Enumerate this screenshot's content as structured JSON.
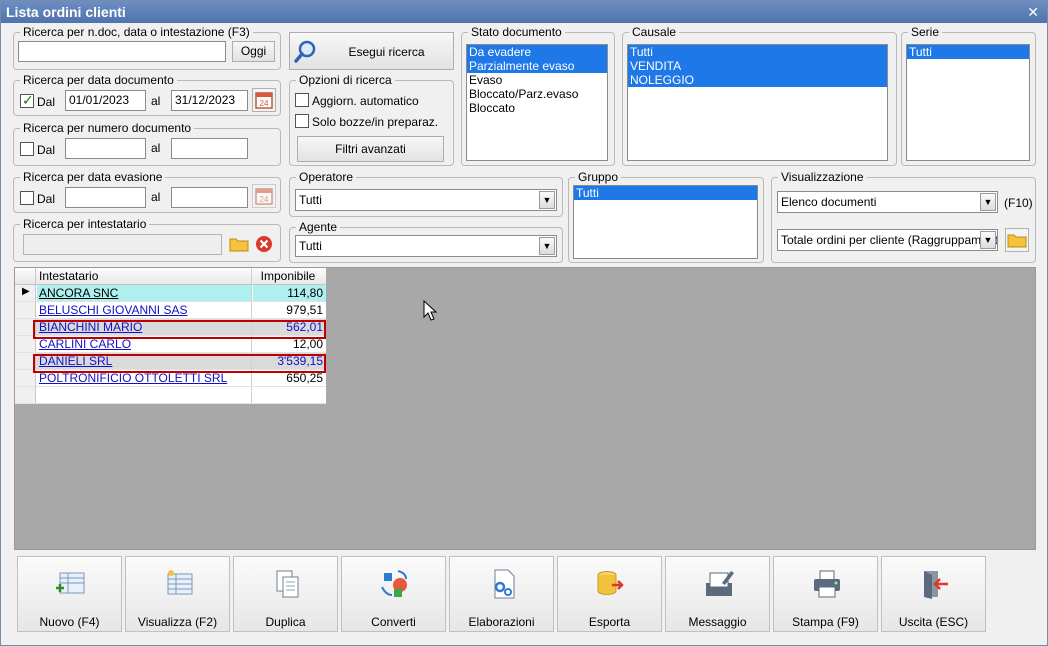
{
  "window": {
    "title": "Lista ordini clienti"
  },
  "search_doc": {
    "legend": "Ricerca per n.doc, data o intestazione (F3)",
    "value": "",
    "oggi_label": "Oggi"
  },
  "execute": {
    "label": "Esegui ricerca"
  },
  "date_doc": {
    "legend": "Ricerca per data documento",
    "dal_label": "Dal",
    "dal_checked": true,
    "from": "01/01/2023",
    "al_label": "al",
    "to": "31/12/2023"
  },
  "numero_doc": {
    "legend": "Ricerca per numero documento",
    "dal_label": "Dal",
    "al_label": "al",
    "from": "",
    "to": ""
  },
  "date_evas": {
    "legend": "Ricerca per data evasione",
    "dal_label": "Dal",
    "al_label": "al",
    "from": "",
    "to": ""
  },
  "intestatario": {
    "legend": "Ricerca per intestatario",
    "value": ""
  },
  "options": {
    "legend": "Opzioni di ricerca",
    "auto_label": "Aggiorn. automatico",
    "bozze_label": "Solo bozze/in preparaz.",
    "filters_label": "Filtri avanzati"
  },
  "stato": {
    "legend": "Stato documento",
    "items": [
      {
        "label": "Da evadere",
        "selected": true
      },
      {
        "label": "Parzialmente evaso",
        "selected": true
      },
      {
        "label": "Evaso",
        "selected": false
      },
      {
        "label": "Bloccato/Parz.evaso",
        "selected": false
      },
      {
        "label": "Bloccato",
        "selected": false
      }
    ]
  },
  "causale": {
    "legend": "Causale",
    "items": [
      {
        "label": "Tutti",
        "selected": true
      },
      {
        "label": "VENDITA",
        "selected": true
      },
      {
        "label": "NOLEGGIO",
        "selected": true
      }
    ]
  },
  "serie": {
    "legend": "Serie",
    "items": [
      {
        "label": "Tutti",
        "selected": true
      }
    ]
  },
  "operatore": {
    "legend": "Operatore",
    "value": "Tutti"
  },
  "agente": {
    "legend": "Agente",
    "value": "Tutti"
  },
  "gruppo": {
    "legend": "Gruppo",
    "items": [
      {
        "label": "Tutti",
        "selected": true
      }
    ]
  },
  "visualizzazione": {
    "legend": "Visualizzazione",
    "view_value": "Elenco documenti",
    "shortcut": "(F10)",
    "totale_value": "Totale ordini per cliente (Raggruppamento)"
  },
  "grid": {
    "columns": [
      "Intestatario",
      "Imponibile"
    ],
    "rows": [
      {
        "name": "ANCORA SNC",
        "value": "114,80"
      },
      {
        "name": "BELUSCHI GIOVANNI SAS",
        "value": "979,51"
      },
      {
        "name": "BIANCHINI MARIO",
        "value": "562,01"
      },
      {
        "name": "CARLINI CARLO",
        "value": "12,00"
      },
      {
        "name": "DANIELI SRL",
        "value": "3'539,15"
      },
      {
        "name": "POLTRONIFICIO OTTOLETTI SRL",
        "value": "650,25"
      },
      {
        "name": "",
        "value": ""
      }
    ]
  },
  "toolbar": [
    {
      "label": "Nuovo (F4)",
      "icon": "new-doc-icon"
    },
    {
      "label": "Visualizza (F2)",
      "icon": "view-doc-icon"
    },
    {
      "label": "Duplica",
      "icon": "duplicate-icon"
    },
    {
      "label": "Converti",
      "icon": "convert-icon"
    },
    {
      "label": "Elaborazioni",
      "icon": "process-icon"
    },
    {
      "label": "Esporta",
      "icon": "export-icon"
    },
    {
      "label": "Messaggio",
      "icon": "message-icon"
    },
    {
      "label": "Stampa (F9)",
      "icon": "print-icon"
    },
    {
      "label": "Uscita (ESC)",
      "icon": "exit-icon"
    }
  ],
  "colors": {
    "title_bar": "#5a7cb5",
    "selection": "#1e78e8",
    "current_row": "#aef0f0",
    "highlight": "#c00000",
    "link": "#1010c8"
  }
}
